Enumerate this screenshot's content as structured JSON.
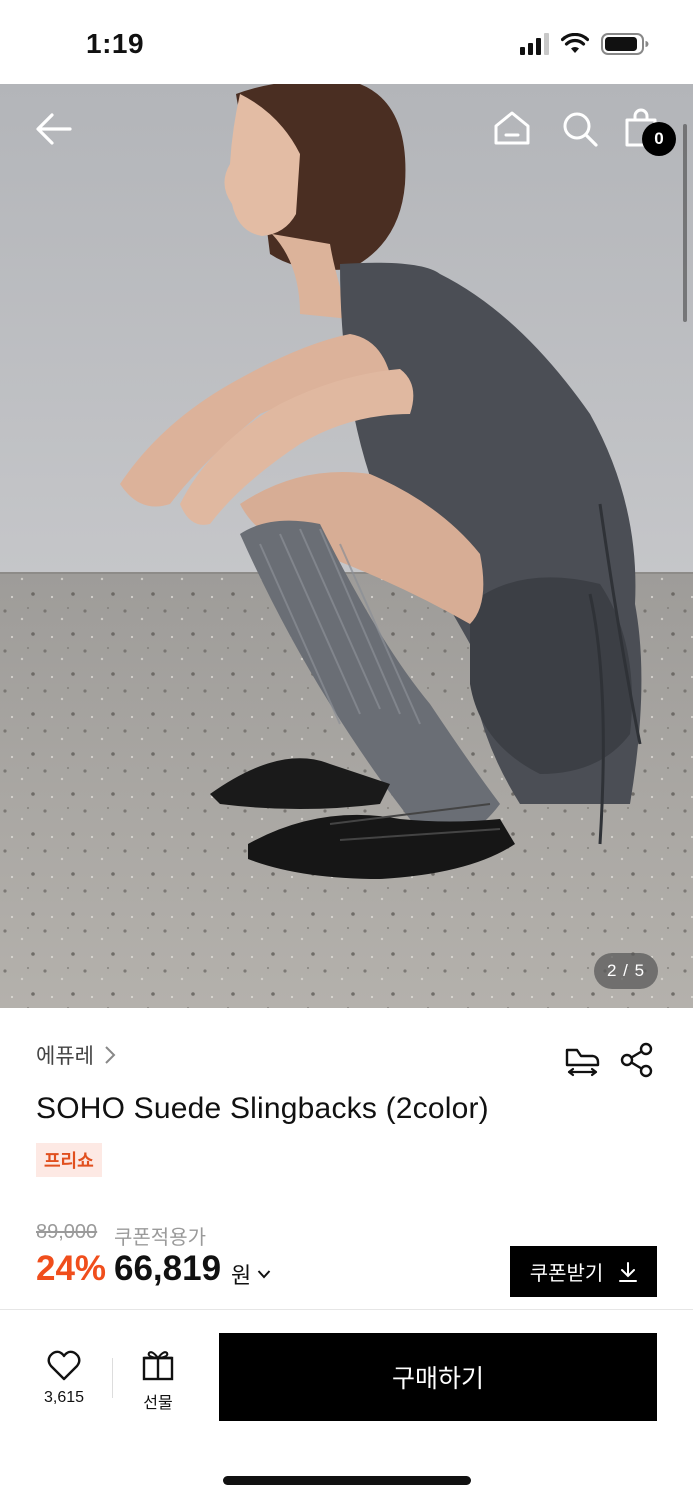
{
  "status_bar": {
    "time": "1:19"
  },
  "gallery": {
    "counter": "2 / 5",
    "cart_count": "0"
  },
  "icons": {
    "back": "back-arrow-icon",
    "home": "home-icon",
    "search": "search-icon",
    "cart": "shopping-bag-icon",
    "brand_chevron": "chevron-right-icon",
    "size": "shoe-size-icon",
    "share": "share-icon",
    "download": "download-icon",
    "heart": "heart-icon",
    "gift": "gift-icon",
    "price_chevron": "chevron-down-icon"
  },
  "product": {
    "brand": "에퓨레",
    "title": "SOHO Suede Slingbacks (2color)",
    "tag": "프리쇼",
    "original_price": "89,000",
    "coupon_applied_label": "쿠폰적용가",
    "discount": "24%",
    "price": "66,819",
    "currency": "원"
  },
  "actions": {
    "coupon_button": "쿠폰받기",
    "like_count": "3,615",
    "gift_label": "선물",
    "buy_button": "구매하기"
  },
  "colors": {
    "accent_discount": "#f04e1c",
    "tag_bg": "#fde9e4",
    "tag_text": "#e1501f",
    "primary_button": "#000000"
  }
}
